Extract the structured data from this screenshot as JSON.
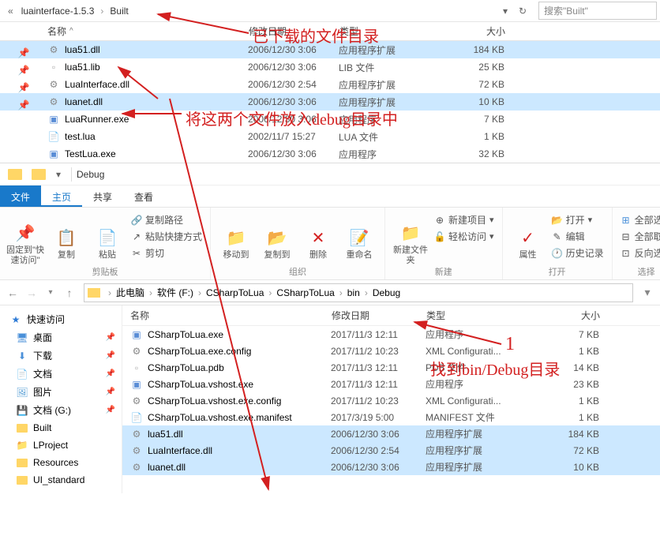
{
  "top_window": {
    "breadcrumb": [
      "luainterface-1.5.3",
      "Built"
    ],
    "search_placeholder": "搜索\"Built\"",
    "columns": {
      "name": "名称",
      "date": "修改日期",
      "type": "类型",
      "size": "大小"
    },
    "files": [
      {
        "name": "lua51.dll",
        "date": "2006/12/30 3:06",
        "type": "应用程序扩展",
        "size": "184 KB",
        "icon": "dll",
        "selected": true
      },
      {
        "name": "lua51.lib",
        "date": "2006/12/30 3:06",
        "type": "LIB 文件",
        "size": "25 KB",
        "icon": "lib"
      },
      {
        "name": "LuaInterface.dll",
        "date": "2006/12/30 2:54",
        "type": "应用程序扩展",
        "size": "72 KB",
        "icon": "dll"
      },
      {
        "name": "luanet.dll",
        "date": "2006/12/30 3:06",
        "type": "应用程序扩展",
        "size": "10 KB",
        "icon": "dll",
        "selected": true
      },
      {
        "name": "LuaRunner.exe",
        "date": "2006/12/30 3:06",
        "type": "应用程序",
        "size": "7 KB",
        "icon": "exe"
      },
      {
        "name": "test.lua",
        "date": "2002/11/7 15:27",
        "type": "LUA 文件",
        "size": "1 KB",
        "icon": "lua"
      },
      {
        "name": "TestLua.exe",
        "date": "2006/12/30 3:06",
        "type": "应用程序",
        "size": "32 KB",
        "icon": "exe"
      }
    ]
  },
  "bottom_window": {
    "title": "Debug",
    "tabs": {
      "file": "文件",
      "home": "主页",
      "share": "共享",
      "view": "查看"
    },
    "ribbon": {
      "pin_label": "固定到\"快速访问\"",
      "copy": "复制",
      "paste": "粘贴",
      "copy_path": "复制路径",
      "paste_shortcut": "粘贴快捷方式",
      "cut": "剪切",
      "clipboard_group": "剪贴板",
      "move_to": "移动到",
      "copy_to": "复制到",
      "delete": "删除",
      "rename": "重命名",
      "organize_group": "组织",
      "new_folder": "新建文件夹",
      "new_item": "新建项目",
      "easy_access": "轻松访问",
      "new_group": "新建",
      "properties": "属性",
      "open": "打开",
      "edit": "编辑",
      "history": "历史记录",
      "open_group": "打开",
      "select_all": "全部选择",
      "select_none": "全部取消",
      "invert": "反向选择",
      "select_group": "选择"
    },
    "breadcrumb": [
      "此电脑",
      "软件 (F:)",
      "CSharpToLua",
      "CSharpToLua",
      "bin",
      "Debug"
    ],
    "columns": {
      "name": "名称",
      "date": "修改日期",
      "type": "类型",
      "size": "大小"
    },
    "sidebar": {
      "quick": "快速访问",
      "desktop": "桌面",
      "downloads": "下载",
      "documents": "文档",
      "pictures": "图片",
      "docs_g": "文档 (G:)",
      "built": "Built",
      "lproject": "LProject",
      "resources": "Resources",
      "ui_standard": "UI_standard"
    },
    "files": [
      {
        "name": "CSharpToLua.exe",
        "date": "2017/11/3 12:11",
        "type": "应用程序",
        "size": "7 KB",
        "icon": "exe"
      },
      {
        "name": "CSharpToLua.exe.config",
        "date": "2017/11/2 10:23",
        "type": "XML Configurati...",
        "size": "1 KB",
        "icon": "config"
      },
      {
        "name": "CSharpToLua.pdb",
        "date": "2017/11/3 12:11",
        "type": "PDB 文件",
        "size": "14 KB",
        "icon": "pdb"
      },
      {
        "name": "CSharpToLua.vshost.exe",
        "date": "2017/11/3 12:11",
        "type": "应用程序",
        "size": "23 KB",
        "icon": "exe"
      },
      {
        "name": "CSharpToLua.vshost.exe.config",
        "date": "2017/11/2 10:23",
        "type": "XML Configurati...",
        "size": "1 KB",
        "icon": "config"
      },
      {
        "name": "CSharpToLua.vshost.exe.manifest",
        "date": "2017/3/19 5:00",
        "type": "MANIFEST 文件",
        "size": "1 KB",
        "icon": "manifest"
      },
      {
        "name": "lua51.dll",
        "date": "2006/12/30 3:06",
        "type": "应用程序扩展",
        "size": "184 KB",
        "icon": "dll",
        "hl": true
      },
      {
        "name": "LuaInterface.dll",
        "date": "2006/12/30 2:54",
        "type": "应用程序扩展",
        "size": "72 KB",
        "icon": "dll",
        "hl": true
      },
      {
        "name": "luanet.dll",
        "date": "2006/12/30 3:06",
        "type": "应用程序扩展",
        "size": "10 KB",
        "icon": "dll",
        "hl": true
      }
    ]
  },
  "annotations": {
    "a1": "已下载的文件目录",
    "a2": "将这两个文件放入debug目录中",
    "a3_num": "1",
    "a3": "找到bin/Debug目录"
  }
}
